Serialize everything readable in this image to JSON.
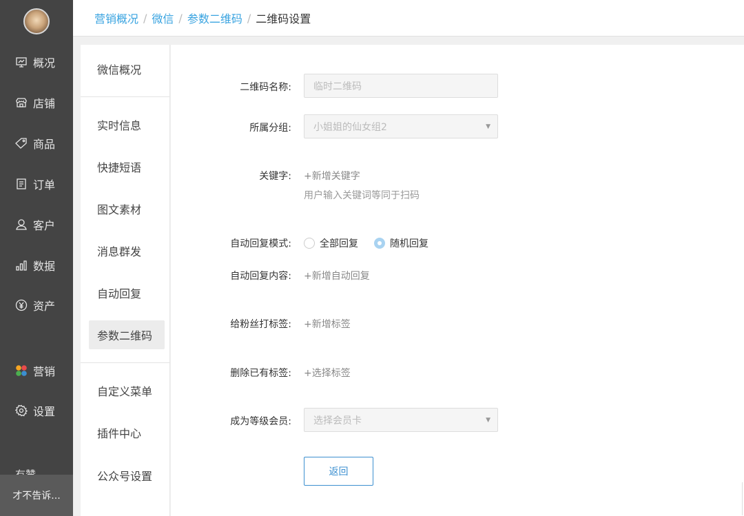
{
  "sidebar": {
    "items": [
      {
        "label": "概况",
        "icon": "dashboard-icon"
      },
      {
        "label": "店铺",
        "icon": "shop-icon"
      },
      {
        "label": "商品",
        "icon": "tag-icon"
      },
      {
        "label": "订单",
        "icon": "order-icon"
      },
      {
        "label": "客户",
        "icon": "user-icon"
      },
      {
        "label": "数据",
        "icon": "bar-chart-icon"
      },
      {
        "label": "资产",
        "icon": "yen-icon"
      },
      {
        "label": "营销",
        "icon": "marketing-icon"
      },
      {
        "label": "设置",
        "icon": "gear-icon"
      }
    ],
    "clipped_item": "有赞",
    "user_name": "才不告诉..."
  },
  "breadcrumb": {
    "items": [
      "营销概况",
      "微信",
      "参数二维码"
    ],
    "current": "二维码设置",
    "separator": "/"
  },
  "subnav": {
    "overview": "微信概况",
    "items": [
      "实时信息",
      "快捷短语",
      "图文素材",
      "消息群发",
      "自动回复",
      "参数二维码"
    ],
    "items2": [
      "自定义菜单",
      "插件中心",
      "公众号设置"
    ],
    "active": "参数二维码"
  },
  "form": {
    "name_label": "二维码名称:",
    "name_placeholder": "临时二维码",
    "group_label": "所属分组:",
    "group_value": "小姐姐的仙女组2",
    "keyword_label": "关键字:",
    "keyword_add": "+新增关键字",
    "keyword_hint": "用户输入关键词等同于扫码",
    "reply_mode_label": "自动回复模式:",
    "reply_mode_options": [
      "全部回复",
      "随机回复"
    ],
    "reply_mode_selected": "随机回复",
    "reply_content_label": "自动回复内容:",
    "reply_content_add": "+新增自动回复",
    "tag_label": "给粉丝打标签:",
    "tag_add": "+新增标签",
    "remove_tag_label": "删除已有标签:",
    "remove_tag_select": "+选择标签",
    "member_label": "成为等级会员:",
    "member_placeholder": "选择会员卡",
    "back_button": "返回"
  },
  "colors": {
    "sidebar_bg": "#444444",
    "link_blue": "#38a3e0",
    "button_blue": "#3b8fd0",
    "radio_selected": "#a9d3f1"
  }
}
